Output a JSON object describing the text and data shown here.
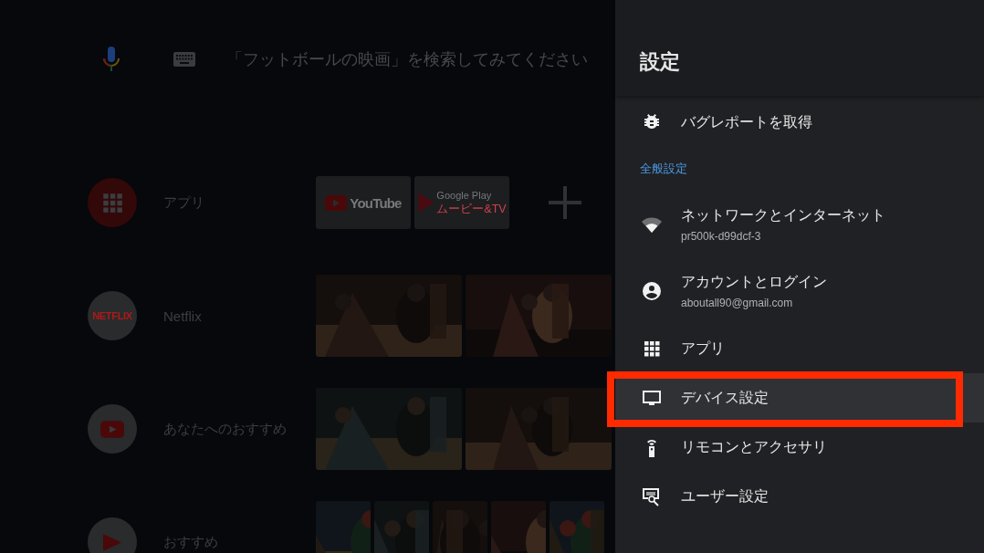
{
  "search": {
    "placeholder": "「フットボールの映画」を検索してみてください"
  },
  "rows": [
    {
      "kind": "apps",
      "label": "アプリ",
      "tiles": [
        {
          "kind": "youtube",
          "label": "YouTube"
        },
        {
          "kind": "play_movies",
          "label": "Google Play",
          "sublabel": "ムービー&TV"
        },
        {
          "kind": "add"
        }
      ]
    },
    {
      "kind": "netflix",
      "label": "Netflix",
      "badge": "NETFLIX"
    },
    {
      "kind": "youtube",
      "label": "あなたへのおすすめ"
    },
    {
      "kind": "movies",
      "label": "おすすめ"
    }
  ],
  "settings": {
    "title": "設定",
    "items": [
      {
        "kind": "bug",
        "label": "バグレポートを取得",
        "selected": false,
        "highlighted": false
      },
      {
        "kind": "section",
        "label": "全般設定"
      },
      {
        "kind": "network",
        "label": "ネットワークとインターネット",
        "sublabel": "pr500k-d99dcf-3",
        "selected": false,
        "highlighted": false
      },
      {
        "kind": "account",
        "label": "アカウントとログイン",
        "sublabel": "aboutall90@gmail.com",
        "selected": false,
        "highlighted": false
      },
      {
        "kind": "apps",
        "label": "アプリ",
        "selected": false,
        "highlighted": false
      },
      {
        "kind": "device",
        "label": "デバイス設定",
        "selected": true,
        "highlighted": true
      },
      {
        "kind": "remote",
        "label": "リモコンとアクセサリ",
        "selected": false,
        "highlighted": false
      },
      {
        "kind": "user",
        "label": "ユーザー設定",
        "selected": false,
        "highlighted": false
      }
    ]
  }
}
